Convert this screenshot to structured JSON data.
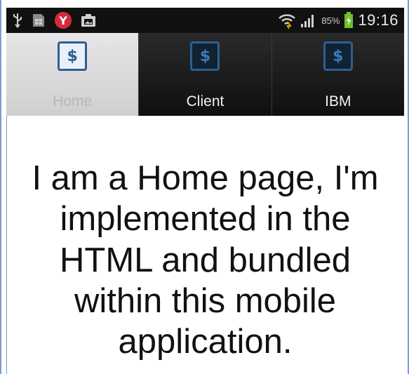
{
  "status_bar": {
    "battery_percent": "85%",
    "time": "19:16",
    "icons": [
      "usb-icon",
      "sim-icon",
      "yandex-icon",
      "gallery-icon",
      "wifi-icon",
      "signal-icon",
      "battery-icon"
    ]
  },
  "tabs": [
    {
      "label": "Home",
      "icon": "dollar-icon",
      "active": true
    },
    {
      "label": "Client",
      "icon": "dollar-icon",
      "active": false
    },
    {
      "label": "IBM",
      "icon": "dollar-icon",
      "active": false
    }
  ],
  "tab_icon_glyph": "$",
  "page": {
    "text": "I am a Home page, I'm implemented in the HTML and bundled within this mobile application."
  },
  "colors": {
    "status_bar_bg": "#111111",
    "active_tab_bg": "#d9d9d9",
    "inactive_tab_bg": "#1a1a1a",
    "icon_blue": "#2f5d96",
    "frame_border": "#7a9bd6"
  }
}
